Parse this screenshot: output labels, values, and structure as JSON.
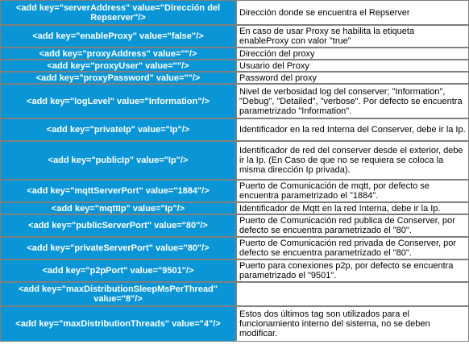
{
  "rows": [
    {
      "key": "<add key=\"serverAddress\" value=\"Dirección del Repserver\"/>",
      "desc": "Dirección donde se encuentra el Repserver"
    },
    {
      "key": "<add key=\"enableProxy\" value=\"false\"/>",
      "desc": "En caso de usar Proxy se habilita la etiqueta enableProxy con valor \"true\""
    },
    {
      "key": "<add key=\"proxyAddress\" value=\"\"/>",
      "desc": "Dirección del proxy"
    },
    {
      "key": "<add key=\"proxyUser\" value=\"\"/>",
      "desc": "Usuario del Proxy"
    },
    {
      "key": "<add key=\"proxyPassword\" value=\"\"/>",
      "desc": "Password del proxy"
    },
    {
      "key": "<add key=\"logLevel\" value=\"Information\"/>",
      "desc": "Nivel de verbosidad log del conserver; \"Information\", \"Debug\", \"Detailed\", \"verbose\". Por defecto se encuentra parametrizado \"Information\"."
    },
    {
      "key": "<add key=\"privateIp\" value=\"Ip\"/>",
      "desc": "Identificador en la red Interna del Conserver, debe ir la Ip."
    },
    {
      "key": "<add key=\"publicIp\" value=\"Ip\"/>",
      "desc": "Identificador de red del conserver desde el exterior, debe ir la Ip. (En Caso de que no se requiera se coloca la misma dirección Ip privada)."
    },
    {
      "key": "<add key=\"mqttServerPort\" value=\"1884\"/>",
      "desc": "Puerto de Comunicación de mqtt, por defecto se encuentra parametrizado el \"1884\"."
    },
    {
      "key": "<add key=\"mqttIp\" value=\"Ip\"/>",
      "desc": "Identificador de Mqtt en la red Interna, debe ir la Ip."
    },
    {
      "key": "<add key=\"publicServerPort\" value=\"80\"/>",
      "desc": "Puerto de Comunicación red publica de Conserver, por defecto se encuentra parametrizado el \"80\"."
    },
    {
      "key": "<add key=\"privateServerPort\" value=\"80\"/>",
      "desc": "Puerto de Comunicación red privada de Conserver, por defecto se encuentra parametrizado el \"80\"."
    },
    {
      "key": "<add key=\"p2pPort\" value=\"9501\"/>",
      "desc": "Puerto para conexiones p2p, por defecto se encuentra parametrizado el \"9501\"."
    },
    {
      "key": "<add key=\"maxDistributionSleepMsPerThread\" value=\"8\"/>",
      "desc": ""
    },
    {
      "key": "<add key=\"maxDistributionThreads\" value=\"4\"/>",
      "desc": "Estos dos últimos tag son utilizados para el funcionamiento interno del sistema, no se deben modificar."
    }
  ]
}
